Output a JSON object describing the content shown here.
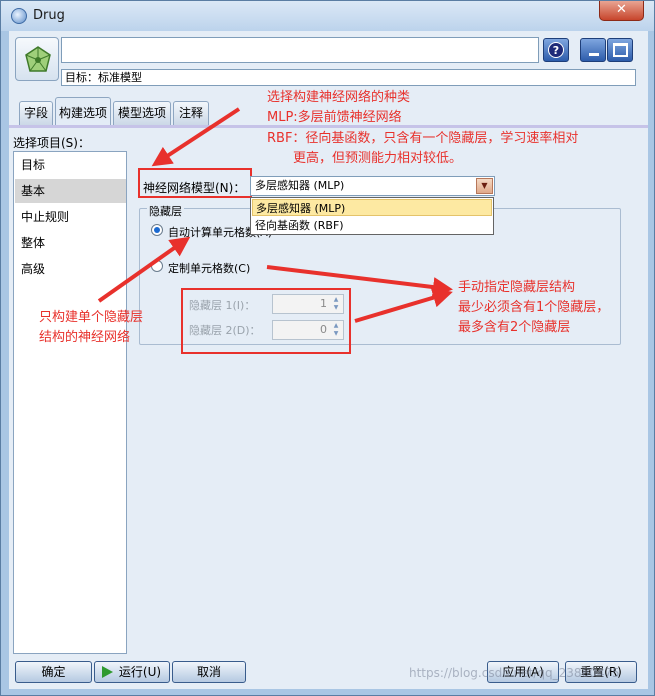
{
  "window": {
    "title": "Drug",
    "close_glyph": "✕"
  },
  "header": {
    "node_name_value": "",
    "target_label": "目标：标准模型",
    "help_glyph": "?"
  },
  "tabs": [
    {
      "label": "字段"
    },
    {
      "label": "构建选项"
    },
    {
      "label": "模型选项"
    },
    {
      "label": "注释"
    }
  ],
  "left": {
    "title": "选择项目(S)：",
    "items": [
      {
        "label": "目标"
      },
      {
        "label": "基本"
      },
      {
        "label": "中止规则"
      },
      {
        "label": "整体"
      },
      {
        "label": "高级"
      }
    ]
  },
  "basic": {
    "nn_model_label": "神经网络模型(N)：",
    "nn_model_value": "多层感知器 (MLP)",
    "dropdown_options": [
      {
        "label": "多层感知器 (MLP)"
      },
      {
        "label": "径向基函数 (RBF)"
      }
    ],
    "hidden_group_title": "隐藏层",
    "auto_radio_label": "自动计算单元格数(A)",
    "custom_radio_label": "定制单元格数(C)",
    "hidden_layer1_label": "隐藏层 1(I)：",
    "hidden_layer1_value": "1",
    "hidden_layer2_label": "隐藏层 2(D)：",
    "hidden_layer2_value": "0"
  },
  "annotations": {
    "model_types": [
      "选择构建神经网络的种类",
      "MLP:多层前馈神经网络"
    ],
    "rbf_note": [
      "RBF：径向基函数，只含有一个隐藏层，学习速率相对",
      "更高，但预测能力相对较低。"
    ],
    "single_layer": [
      "只构建单个隐藏层",
      "结构的神经网络"
    ],
    "manual_hidden": [
      "手动指定隐藏层结构",
      "最少必须含有1个隐藏层，",
      "最多含有2个隐藏层"
    ]
  },
  "footer": {
    "ok": "确定",
    "run": "运行(U)",
    "cancel": "取消",
    "apply": "应用(A)",
    "reset": "重置(R)"
  },
  "watermark": "https://blog.csdn.net/qq_23860475",
  "colors": {
    "annotation_red": "#e8312c",
    "window_frame": "#a9c6e4"
  }
}
